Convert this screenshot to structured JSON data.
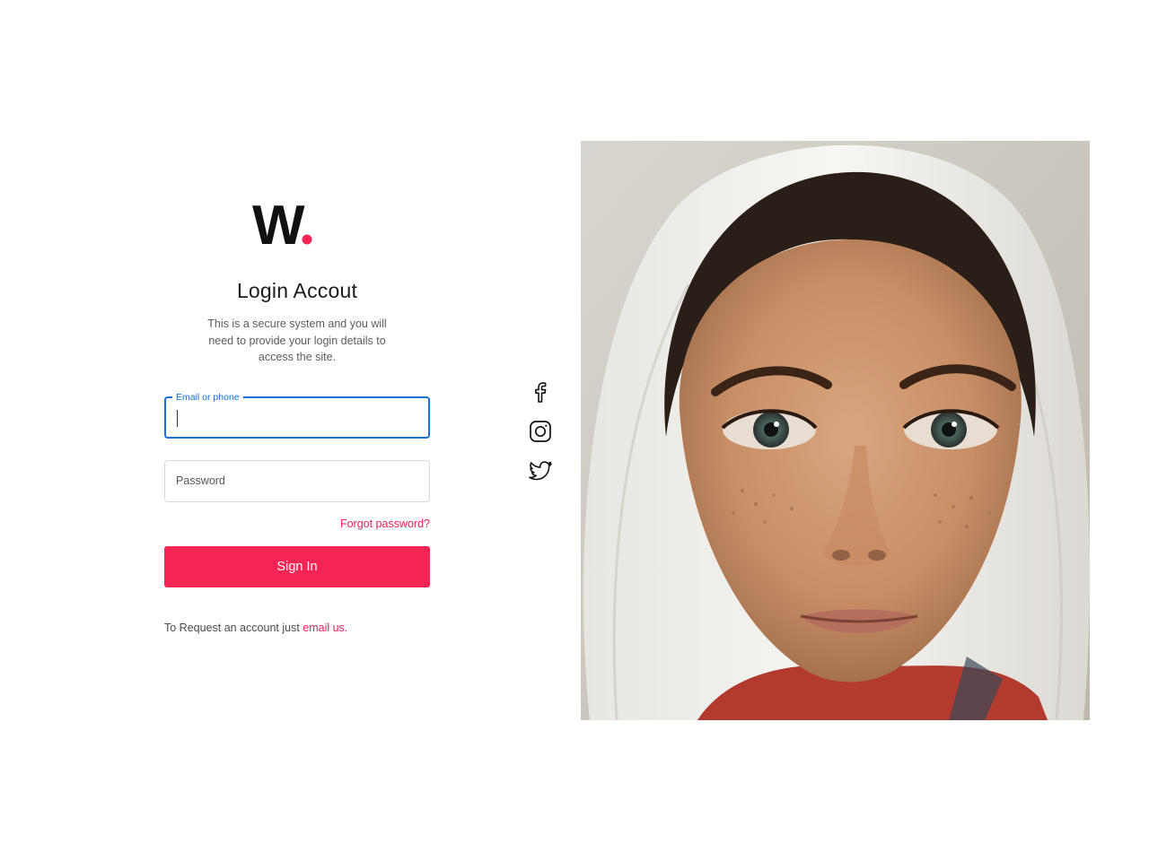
{
  "brand": {
    "logo_letter": "W",
    "logo_dot": ".",
    "dot_color": "#f42454"
  },
  "login": {
    "title": "Login Accout",
    "subtitle": "This is a secure system and you will need to provide your login details to access the site.",
    "email_label": "Email or phone",
    "email_value": "",
    "password_placeholder": "Password",
    "forgot_label": "Forgot password?",
    "signin_label": "Sign In",
    "request_text": "To Request an account just ",
    "request_link": "email us."
  },
  "social": [
    {
      "icon": "facebook-icon"
    },
    {
      "icon": "instagram-icon"
    },
    {
      "icon": "twitter-icon"
    }
  ],
  "colors": {
    "accent": "#f42454",
    "link": "#e3235b",
    "focus": "#1a6fd8"
  }
}
